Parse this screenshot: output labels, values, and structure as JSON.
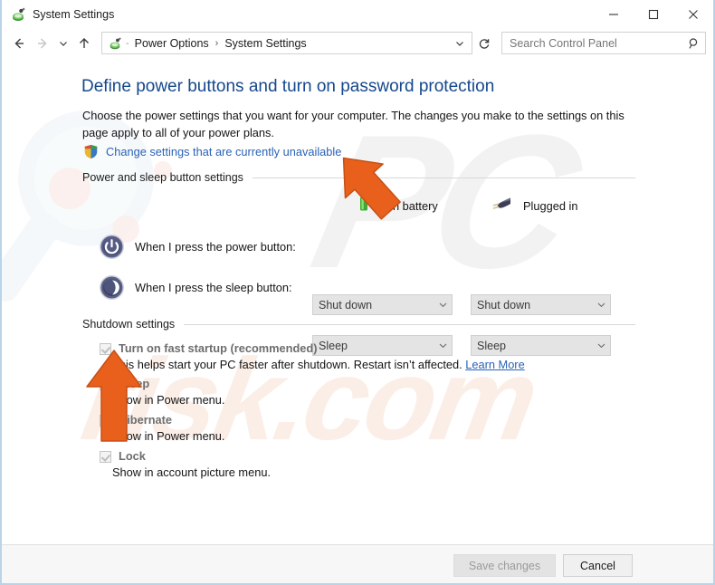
{
  "window": {
    "title": "System Settings",
    "app_icon": "power-options-icon",
    "controls": {
      "minimize": "minimize-icon",
      "maximize": "maximize-icon",
      "close": "close-icon"
    }
  },
  "addressbar": {
    "back": "back-arrow-icon",
    "forward": "forward-arrow-icon",
    "recent": "chevron-down-icon",
    "up": "up-arrow-icon",
    "breadcrumb_icon": "power-options-icon",
    "breadcrumb_separator_dash": "-",
    "breadcrumbs": [
      {
        "label": "Power Options"
      },
      {
        "label": "System Settings"
      }
    ],
    "breadcrumb_separator": "›",
    "dropdown": "chevron-down-icon",
    "refresh": "refresh-icon",
    "search": {
      "placeholder": "Search Control Panel",
      "value": "",
      "icon": "search-icon"
    }
  },
  "page": {
    "heading": "Define power buttons and turn on password protection",
    "description": "Choose the power settings that you want for your computer. The changes you make to the settings on this page apply to all of your power plans.",
    "uac_link": {
      "icon": "uac-shield-icon",
      "label": "Change settings that are currently unavailable"
    }
  },
  "power_section": {
    "group_title": "Power and sleep button settings",
    "columns": [
      {
        "label": "On battery",
        "icon": "battery-icon"
      },
      {
        "label": "Plugged in",
        "icon": "power-plug-icon"
      }
    ],
    "rows": [
      {
        "icon": "power-button-icon",
        "label": "When I press the power button:",
        "on_battery": "Shut down",
        "plugged_in": "Shut down",
        "disabled": true
      },
      {
        "icon": "sleep-button-icon",
        "label": "When I press the sleep button:",
        "on_battery": "Sleep",
        "plugged_in": "Sleep",
        "disabled": true
      }
    ]
  },
  "shutdown_section": {
    "group_title": "Shutdown settings",
    "items": [
      {
        "label": "Turn on fast startup (recommended)",
        "checked": true,
        "disabled": true,
        "description_prefix": "This helps start your PC faster after shutdown. Restart isn’t affected. ",
        "description_link": "Learn More"
      },
      {
        "label": "Sleep",
        "checked": true,
        "disabled": true,
        "description_prefix": "Show in Power menu.",
        "description_link": ""
      },
      {
        "label": "Hibernate",
        "checked": false,
        "disabled": true,
        "description_prefix": "Show in Power menu.",
        "description_link": ""
      },
      {
        "label": "Lock",
        "checked": true,
        "disabled": true,
        "description_prefix": "Show in account picture menu.",
        "description_link": ""
      }
    ]
  },
  "footer": {
    "save_label": "Save changes",
    "save_disabled": true,
    "cancel_label": "Cancel"
  },
  "watermark": {
    "brand_mark": "PC",
    "brand_text": "risk.com"
  },
  "annotations": [
    {
      "name": "arrow-pointing-to-change-settings-link",
      "color": "#e8601c"
    },
    {
      "name": "arrow-pointing-to-fast-startup-checkbox",
      "color": "#e8601c"
    }
  ],
  "colors": {
    "heading": "#15488c",
    "link": "#2a62b6",
    "annotation": "#e8601c",
    "window_border": "#b9d4e8"
  }
}
